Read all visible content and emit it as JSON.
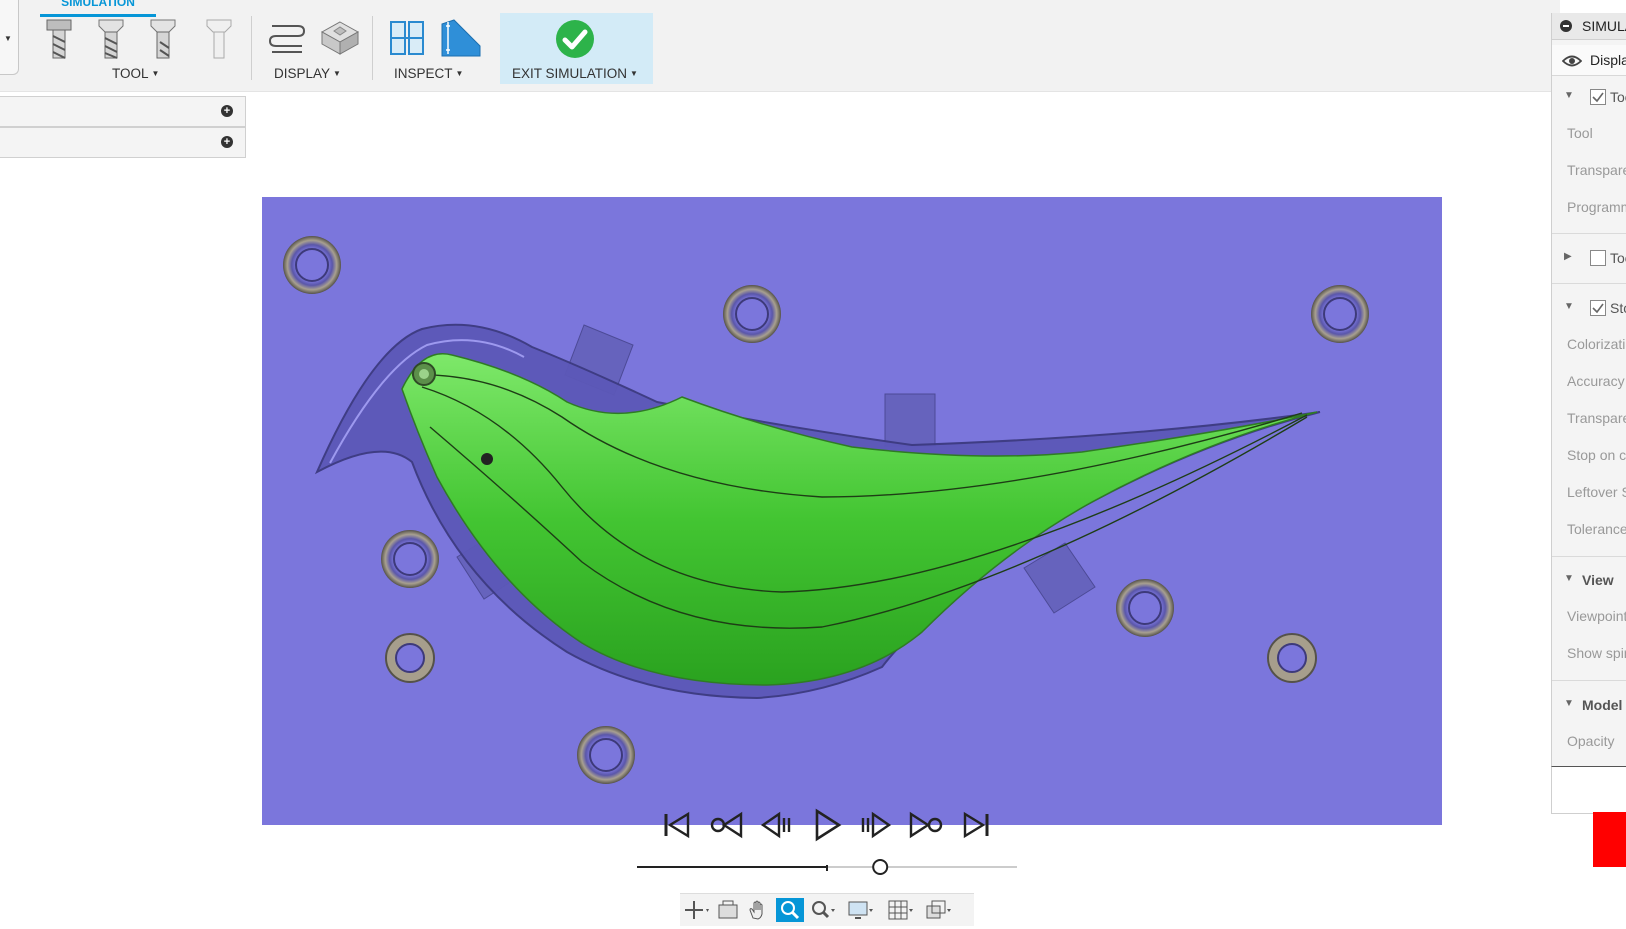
{
  "toolbar": {
    "active_tab": "SIMULATION",
    "groups": {
      "tool": "TOOL",
      "display": "DISPLAY",
      "inspect": "INSPECT",
      "exit_simulation": "EXIT SIMULATION"
    }
  },
  "panel": {
    "title": "SIMULATION",
    "tab": "Display",
    "sections": [
      {
        "label": "Tool",
        "checked": true,
        "expanded": true
      },
      {
        "label": "Toolpath",
        "checked": false,
        "expanded": false
      },
      {
        "label": "Stock",
        "checked": true,
        "expanded": true
      }
    ],
    "tool_rows": [
      "Tool",
      "Transparent",
      "Programmed"
    ],
    "stock_rows": [
      "Colorization",
      "Accuracy",
      "Transparent",
      "Stop on collision",
      "Leftover Stock",
      "Tolerance"
    ],
    "view_label": "View",
    "view_rows": [
      "Viewpoint",
      "Show spindle"
    ],
    "model_label": "Model",
    "model_rows": [
      "Opacity"
    ]
  },
  "playback": {
    "buttons": [
      "go-to-start",
      "previous-operation",
      "step-back",
      "play",
      "step-forward",
      "next-operation",
      "go-to-end"
    ],
    "slider_position": 0.64
  },
  "colors": {
    "stock": "#7b76dc",
    "part": "#4ec23a",
    "accent": "#0696d7",
    "exit_check": "#2db34a"
  }
}
